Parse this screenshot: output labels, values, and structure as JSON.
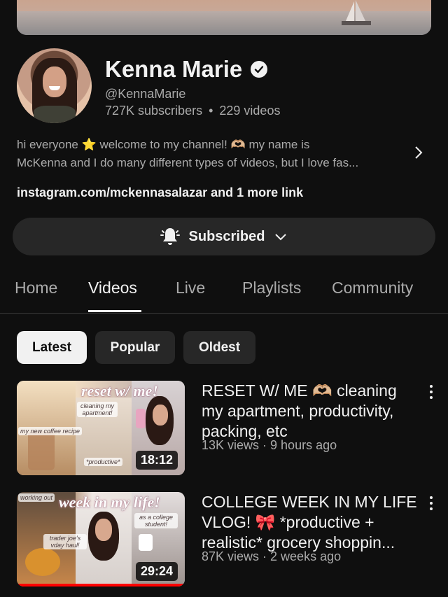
{
  "channel": {
    "name": "Kenna Marie",
    "handle": "@KennaMarie",
    "subscribers": "727K subscribers",
    "separator": "•",
    "video_count": "229 videos",
    "description_line1": "hi everyone ⭐ welcome to my channel! 🫶🏼 my name is",
    "description_line2": "McKenna and I do many different types of videos, but I love fas...",
    "link_text": "instagram.com/mckennasalazar and 1 more link",
    "subscribe_label": "Subscribed",
    "icons": [
      "verified-badge-icon",
      "bell-icon",
      "chevron-down-icon",
      "chevron-right-icon"
    ]
  },
  "tabs": [
    {
      "label": "Home"
    },
    {
      "label": "Videos",
      "active": true
    },
    {
      "label": "Live"
    },
    {
      "label": "Playlists"
    },
    {
      "label": "Community"
    }
  ],
  "filters": [
    {
      "label": "Latest",
      "active": true
    },
    {
      "label": "Popular"
    },
    {
      "label": "Oldest"
    }
  ],
  "videos": [
    {
      "title": "RESET W/ ME 🫶🏼 cleaning my apartment, productivity, packing, etc",
      "meta": "13K views · 9 hours ago",
      "duration": "18:12",
      "thumb_title": "reset w/ me!",
      "thumb_tags": [
        "cleaning my apartment!",
        "my new coffee recipe",
        "*productive*"
      ]
    },
    {
      "title": "COLLEGE WEEK IN MY LIFE VLOG! 🎀 *productive + realistic* grocery shoppin...",
      "meta": "87K views · 2 weeks ago",
      "duration": "29:24",
      "watched_fraction": 1.0,
      "thumb_title": "week in my life!",
      "thumb_tags": [
        "working out",
        "as a college student!",
        "trader joe's vday haul!"
      ]
    }
  ],
  "colors": {
    "background": "#0f0f0f",
    "chip": "#272727",
    "secondary_text": "#aaaaaa",
    "progress": "#ff0000"
  }
}
